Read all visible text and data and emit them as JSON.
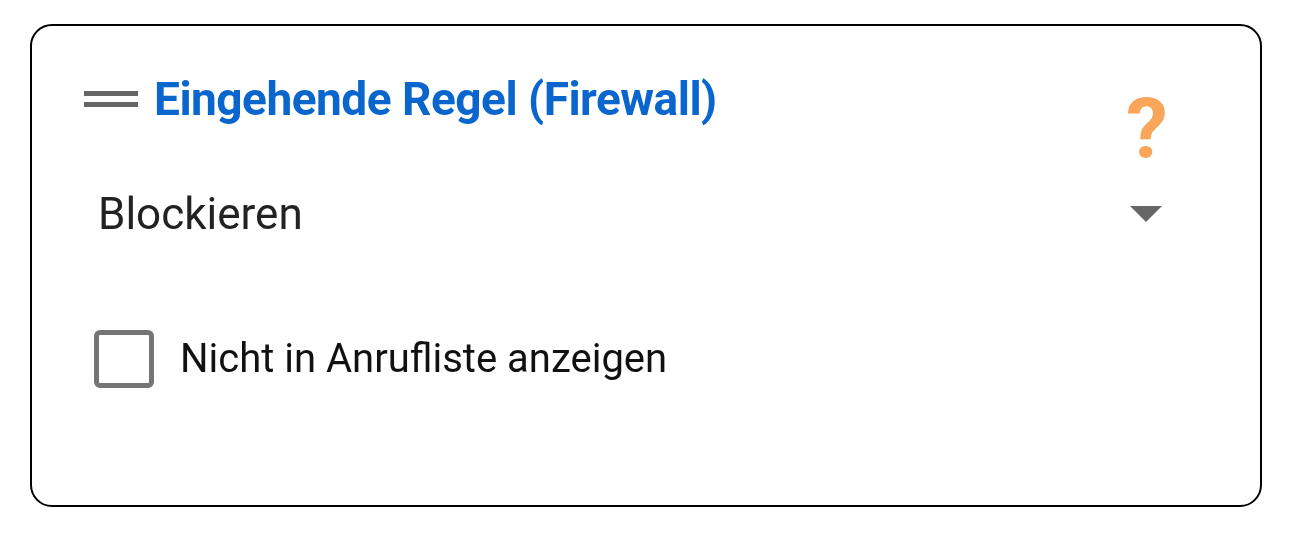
{
  "card": {
    "title": "Eingehende Regel (Firewall)",
    "help": "?",
    "dropdown": {
      "value": "Blockieren"
    },
    "checkbox": {
      "label": "Nicht in Anrufliste anzeigen",
      "checked": false
    }
  }
}
